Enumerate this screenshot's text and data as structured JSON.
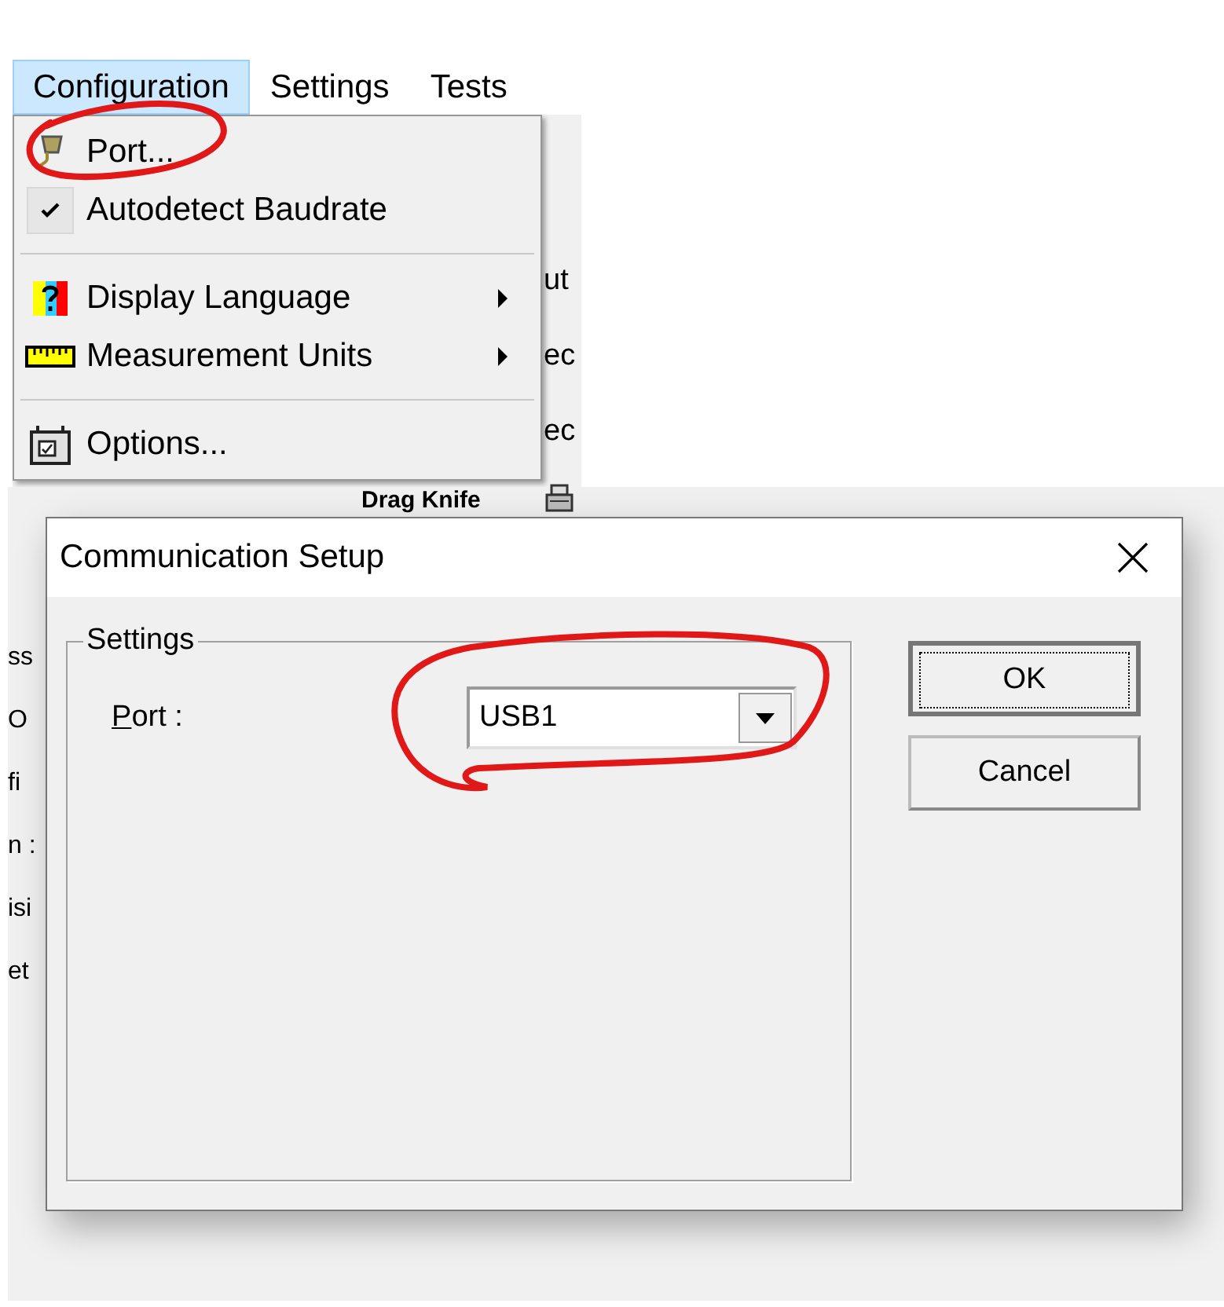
{
  "menu_bar": {
    "items": [
      {
        "label": "Configuration",
        "selected": true
      },
      {
        "label": "Settings",
        "selected": false
      },
      {
        "label": "Tests",
        "selected": false
      }
    ]
  },
  "menu": {
    "items": [
      {
        "kind": "command",
        "label": "Port..."
      },
      {
        "kind": "check",
        "label": "Autodetect Baudrate",
        "checked": true
      },
      {
        "kind": "separator"
      },
      {
        "kind": "submenu",
        "label": "Display Language"
      },
      {
        "kind": "submenu",
        "label": "Measurement Units"
      },
      {
        "kind": "separator"
      },
      {
        "kind": "command",
        "label": "Options..."
      }
    ]
  },
  "background": {
    "fragments_right": [
      "ut",
      "ec",
      "ec"
    ],
    "heading": "Drag Knife",
    "fragments_left": [
      "ss",
      "O",
      "fi",
      "n :",
      "isi",
      "et"
    ]
  },
  "dialog": {
    "title": "Communication Setup",
    "group": {
      "title": "Settings",
      "port_label": "Port :",
      "port_value": "USB1"
    },
    "buttons": [
      {
        "label": "OK",
        "default": true
      },
      {
        "label": "Cancel",
        "default": false
      }
    ]
  }
}
